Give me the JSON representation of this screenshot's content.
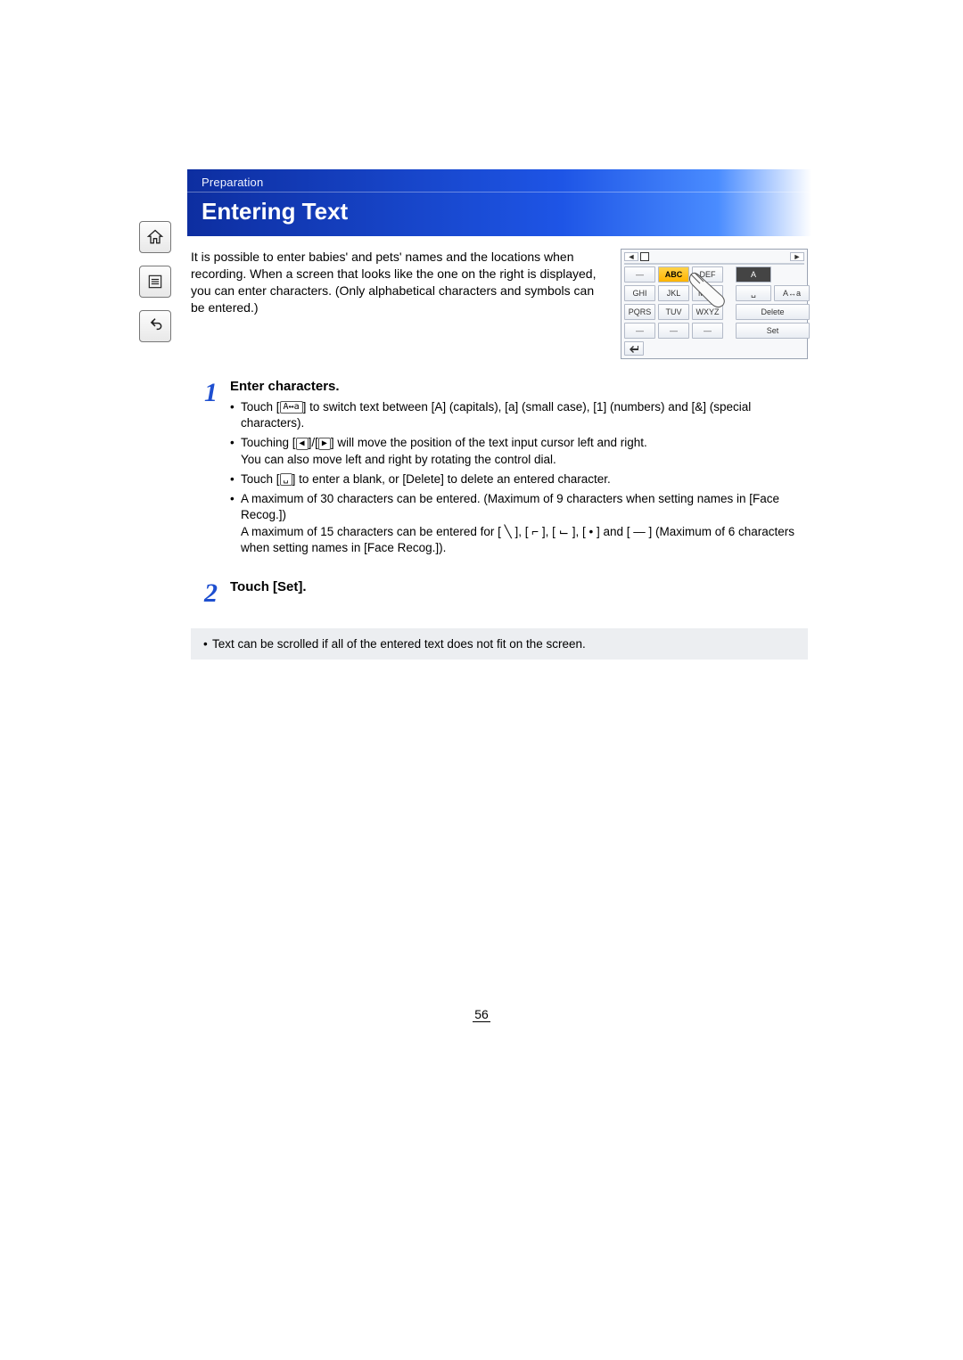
{
  "breadcrumb": "Preparation",
  "title": "Entering Text",
  "intro": "It is possible to enter babies' and pets' names and the locations when recording. When a screen that looks like the one on the right is displayed, you can enter characters. (Only alphabetical characters and symbols can be entered.)",
  "keypad": {
    "row1": [
      "—",
      "ABC",
      "DEF"
    ],
    "row1_right": [
      "A",
      ""
    ],
    "row2": [
      "GHI",
      "JKL",
      "MNO"
    ],
    "row2_right": [
      "␣",
      "A↔a"
    ],
    "row3": [
      "PQRS",
      "TUV",
      "WXYZ"
    ],
    "row3_right": [
      "Delete"
    ],
    "row4": [
      "—",
      "—",
      "—"
    ],
    "row4_right": [
      "Set"
    ],
    "cursor_left": "◄",
    "cursor_right": "►",
    "return_icon": "↩"
  },
  "steps": [
    {
      "num": "1",
      "title": "Enter characters.",
      "bullets": [
        {
          "text_a": "Touch [",
          "icon": "A↔a",
          "text_b": "] to switch text between [A] (capitals), [a] (small case), [1] (numbers) and [&] (special characters)."
        },
        {
          "text_a": "Touching [",
          "icon": "◀",
          "mid": "]/[",
          "icon2": "▶",
          "text_b": "] will move the position of the text input cursor left and right.",
          "sub": "You can also move left and right by rotating the control dial."
        },
        {
          "text_a": "Touch [",
          "icon": "␣",
          "text_b": "] to enter a blank, or [Delete] to delete an entered character."
        },
        {
          "text_plain": "A maximum of 30 characters can be entered. (Maximum of 9 characters when setting names in [Face Recog.])",
          "sub": "A maximum of 15 characters can be entered for [ ╲ ], [ ⌐ ], [ ⌙ ], [ • ] and [ — ] (Maximum of 6 characters when setting names in [Face Recog.])."
        }
      ]
    },
    {
      "num": "2",
      "title": "Touch [Set].",
      "bullets": []
    }
  ],
  "note": "Text can be scrolled if all of the entered text does not fit on the screen.",
  "page_number": "56"
}
